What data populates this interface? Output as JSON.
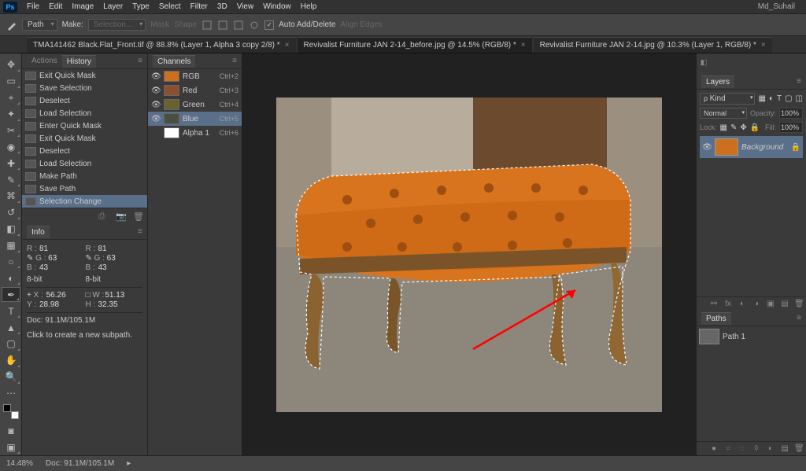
{
  "app": {
    "user": "Md_Suhail"
  },
  "menu": [
    "File",
    "Edit",
    "Image",
    "Layer",
    "Type",
    "Select",
    "Filter",
    "3D",
    "View",
    "Window",
    "Help"
  ],
  "options": {
    "tool_mode": "Path",
    "make": "Make:",
    "selection": "Selection...",
    "mask": "Mask",
    "shape": "Shape",
    "auto_add": "Auto Add/Delete",
    "align": "Align Edges"
  },
  "doc_tabs": [
    {
      "label": "TMA141462 Black.Flat_Front.tif @ 88.8% (Layer 1, Alpha 3 copy 2/8) *",
      "active": false
    },
    {
      "label": "Revivalist Furniture JAN 2-14_before.jpg @ 14.5% (RGB/8) *",
      "active": true
    },
    {
      "label": "Revivalist Furniture JAN 2-14.jpg @ 10.3% (Layer 1, RGB/8) *",
      "active": false
    }
  ],
  "history": {
    "tabs": [
      "Actions",
      "History"
    ],
    "active_tab": "History",
    "items": [
      "Exit Quick Mask",
      "Save Selection",
      "Deselect",
      "Load Selection",
      "Enter Quick Mask",
      "Exit Quick Mask",
      "Deselect",
      "Load Selection",
      "Make Path",
      "Save Path",
      "Selection Change"
    ],
    "selected": "Selection Change"
  },
  "info": {
    "title": "Info",
    "R1": "81",
    "G1": "63",
    "B1": "43",
    "R2": "81",
    "G2": "63",
    "B2": "43",
    "bit1": "8-bit",
    "bit2": "8-bit",
    "X": "56.26",
    "Y": "28.98",
    "W": "51.13",
    "H": "32.35",
    "doc": "Doc: 91.1M/105.1M",
    "hint": "Click to create a new subpath."
  },
  "channels": {
    "title": "Channels",
    "items": [
      {
        "name": "RGB",
        "shortcut": "Ctrl+2",
        "thumb": "#cc7020",
        "eye": true
      },
      {
        "name": "Red",
        "shortcut": "Ctrl+3",
        "thumb": "#aa5030",
        "eye": true
      },
      {
        "name": "Green",
        "shortcut": "Ctrl+4",
        "thumb": "#887030",
        "eye": true
      },
      {
        "name": "Blue",
        "shortcut": "Ctrl+5",
        "thumb": "#555040",
        "eye": true,
        "selected": true
      },
      {
        "name": "Alpha 1",
        "shortcut": "Ctrl+6",
        "thumb": "#ffffff",
        "eye": false
      }
    ]
  },
  "layers": {
    "title": "Layers",
    "kind": "Kind",
    "blend": "Normal",
    "opacity_label": "Opacity:",
    "opacity": "100%",
    "lock_label": "Lock:",
    "fill_label": "Fill:",
    "fill": "100%",
    "bg": "Background"
  },
  "paths": {
    "title": "Paths",
    "item": "Path 1"
  },
  "status": {
    "zoom": "14.48%",
    "doc": "Doc: 91.1M/105.1M"
  }
}
